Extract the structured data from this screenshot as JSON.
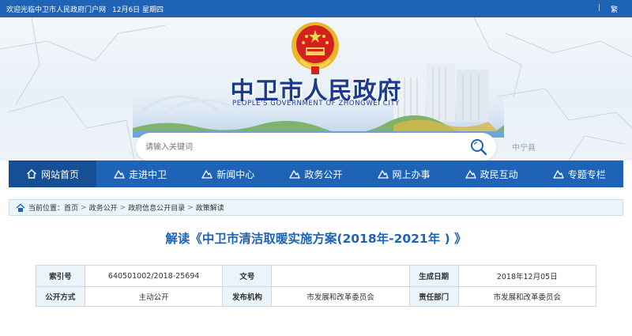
{
  "topbar": {
    "welcome": "欢迎光临中卫市人民政府门户网",
    "date": "12月6日 星期四",
    "lang_separator": "|",
    "lang": "繁"
  },
  "banner": {
    "title_cn": "中卫市人民政府",
    "title_en": "PEOPLE'S GOVERNMENT OF ZHONGWEI CITY",
    "place_label": "中宁县"
  },
  "search": {
    "placeholder": "请输入关键词"
  },
  "nav": {
    "items": [
      {
        "label": "网站首页",
        "icon": "home-icon",
        "active": true
      },
      {
        "label": "走进中卫",
        "icon": "mountain-icon",
        "active": false
      },
      {
        "label": "新闻中心",
        "icon": "mountain-icon",
        "active": false
      },
      {
        "label": "政务公开",
        "icon": "mountain-icon",
        "active": false
      },
      {
        "label": "网上办事",
        "icon": "mountain-icon",
        "active": false
      },
      {
        "label": "政民互动",
        "icon": "mountain-icon",
        "active": false
      },
      {
        "label": "专题专栏",
        "icon": "mountain-icon",
        "active": false
      }
    ]
  },
  "breadcrumb": {
    "prefix": "当前位置：",
    "items": [
      "首页",
      "政务公开",
      "政府信息公开目录",
      "政策解读"
    ],
    "separator": ">"
  },
  "article": {
    "title": "解读《中卫市清洁取暖实施方案(2018年-2021年 ) 》"
  },
  "info": {
    "row1": {
      "k1": "索引号",
      "v1": "640501002/2018-25694",
      "k2": "文号",
      "v2": "",
      "k3": "生成日期",
      "v3": "2018年12月05日"
    },
    "row2": {
      "k1": "公开方式",
      "v1": "主动公开",
      "k2": "发布机构",
      "v2": "市发展和改革委员会",
      "k3": "责任部门",
      "v3": "市发展和改革委员会"
    }
  },
  "colors": {
    "primary": "#1e63b6",
    "nav_active": "#164f94",
    "title": "#1a3b8f",
    "breadcrumb_bg": "#eaf4fb",
    "table_key_bg": "#ebf4fb"
  }
}
